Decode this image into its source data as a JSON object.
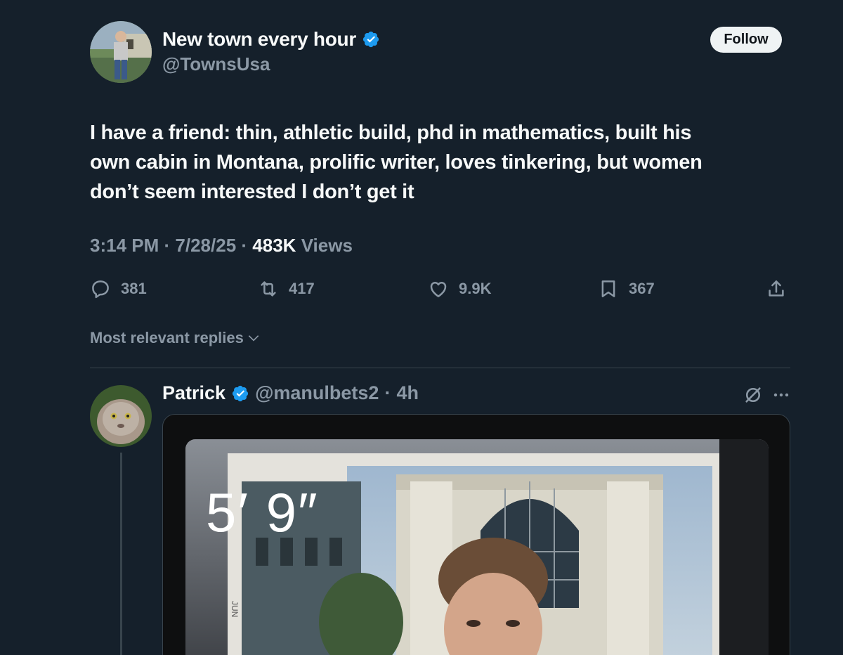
{
  "tweet": {
    "author_name": "New town every hour",
    "author_handle": "@TownsUsa",
    "follow_label": "Follow",
    "text_lines": [
      "I have a friend: thin, athletic build, phd in mathematics, built his",
      "own cabin in Montana, prolific writer, loves tinkering, but women",
      "don’t seem interested I don’t get it"
    ],
    "time": "3:14 PM",
    "date": "7/28/25",
    "separator": "·",
    "views_count": "483K",
    "views_label": "Views",
    "stats": {
      "replies": "381",
      "reposts": "417",
      "likes": "9.9K",
      "bookmarks": "367"
    }
  },
  "replies_sort_label": "Most relevant replies",
  "reply": {
    "name": "Patrick",
    "handle": "@manulbets2",
    "separator": "·",
    "time": "4h",
    "media_caption": "5′ 9″"
  },
  "colors": {
    "background": "#15202b",
    "verified": "#1d9bf0",
    "muted_text": "#8b98a5",
    "primary_text": "#f7f9f9",
    "divider": "#38444d"
  },
  "icons": [
    "verified-badge-icon",
    "reply-icon",
    "repost-icon",
    "like-icon",
    "bookmark-icon",
    "share-icon",
    "chevron-down-icon",
    "grok-icon",
    "more-icon"
  ]
}
